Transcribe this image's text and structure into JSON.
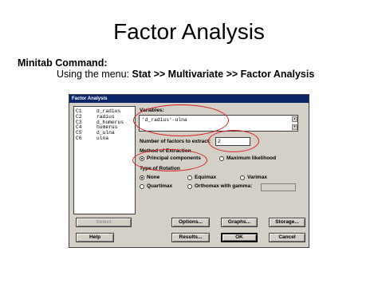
{
  "slide": {
    "title": "Factor Analysis",
    "command_heading": "Minitab Command:",
    "command_prefix": "Using the menu: ",
    "command_path": "Stat >> Multivariate >> Factor Analysis"
  },
  "dialog": {
    "title": "Factor Analysis",
    "variable_list": [
      {
        "col": "C1",
        "name": "d_radius"
      },
      {
        "col": "C2",
        "name": "radius"
      },
      {
        "col": "C3",
        "name": "d_humerus"
      },
      {
        "col": "C4",
        "name": "humerus"
      },
      {
        "col": "C5",
        "name": "d_ulna"
      },
      {
        "col": "C6",
        "name": "ulna"
      }
    ],
    "variables_label": "Variables:",
    "variables_value": "'d_radius'-ulna",
    "num_factors_label": "Number of factors to extract:",
    "num_factors_value": "2",
    "method_label": "Method of Extraction",
    "method_options": [
      "Principal components",
      "Maximum likelihood"
    ],
    "method_selected": "Principal components",
    "rotation_label": "Type of Rotation",
    "rotation_options": [
      "None",
      "Equimax",
      "Varimax",
      "Quartimax",
      "Orthomax with gamma:"
    ],
    "rotation_selected": "None",
    "buttons": {
      "select": "Select",
      "options": "Options...",
      "graphs": "Graphs...",
      "storage": "Storage...",
      "help": "Help",
      "results": "Results...",
      "ok": "OK",
      "cancel": "Cancel"
    }
  },
  "colors": {
    "annotation_red": "#d42020",
    "titlebar": "#0a246a",
    "dialog_face": "#d4d0c8"
  }
}
